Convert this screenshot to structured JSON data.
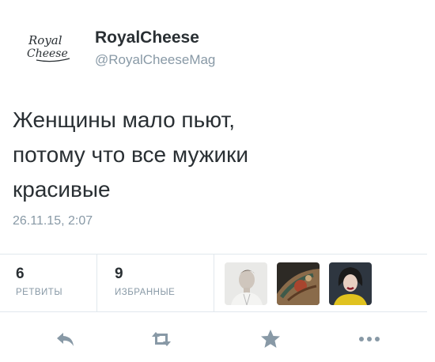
{
  "user": {
    "logo_line1": "Royal",
    "logo_line2": "Cheese",
    "name": "RoyalCheese",
    "handle": "@RoyalCheeseMag"
  },
  "tweet": {
    "text": "Женщины мало пьют,\nпотому что все мужики\nкрасивые",
    "timestamp": "26.11.15, 2:07"
  },
  "stats": {
    "retweets_count": "6",
    "retweets_label": "РЕТВИТЫ",
    "favorites_count": "9",
    "favorites_label": "ИЗБРАННЫЕ"
  },
  "favorited_by": [
    {
      "icon": "user-avatar-man-white"
    },
    {
      "icon": "user-avatar-tattoo"
    },
    {
      "icon": "user-avatar-woman-yellow"
    }
  ],
  "actions": [
    {
      "icon": "reply-icon"
    },
    {
      "icon": "retweet-icon"
    },
    {
      "icon": "favorite-star-icon"
    },
    {
      "icon": "more-icon"
    }
  ],
  "colors": {
    "text": "#292f33",
    "muted": "#8899a6",
    "icon": "#8899a6",
    "border": "#e1e8ed"
  }
}
